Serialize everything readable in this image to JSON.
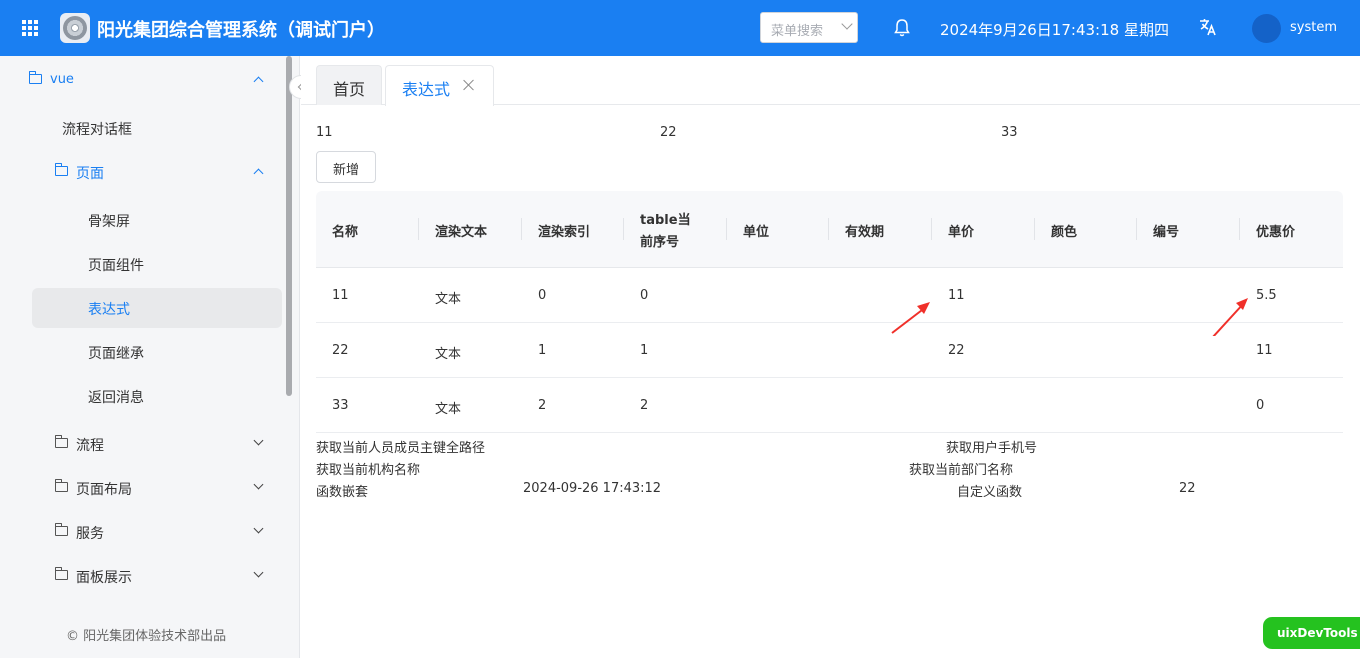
{
  "header": {
    "title": "阳光集团综合管理系统（调试门户）",
    "menu_search_placeholder": "菜单搜索",
    "datetime": "2024年9月26日17:43:18 星期四",
    "username": "system",
    "icons": [
      "apps-grid-icon",
      "logo-disc-icon",
      "bell-icon",
      "translate-icon",
      "avatar"
    ]
  },
  "sidebar": {
    "items": [
      {
        "label": "vue",
        "level": 0,
        "expanded": true
      },
      {
        "label": "流程对话框",
        "level": 1
      },
      {
        "label": "页面",
        "level": 1,
        "expanded": true
      },
      {
        "label": "骨架屏",
        "level": 2
      },
      {
        "label": "页面组件",
        "level": 2
      },
      {
        "label": "表达式",
        "level": 2,
        "selected": true
      },
      {
        "label": "页面继承",
        "level": 2
      },
      {
        "label": "返回消息",
        "level": 2
      },
      {
        "label": "流程",
        "level": 1,
        "expanded": false
      },
      {
        "label": "页面布局",
        "level": 1,
        "expanded": false
      },
      {
        "label": "服务",
        "level": 1,
        "expanded": false
      },
      {
        "label": "面板展示",
        "level": 1,
        "expanded": false
      }
    ],
    "footer": "© 阳光集团体验技术部出品"
  },
  "tabs": [
    {
      "label": "首页",
      "active": false
    },
    {
      "label": "表达式",
      "active": true,
      "closable": true
    }
  ],
  "main": {
    "top_values": [
      "11",
      "22",
      "33"
    ],
    "add_button": "新增",
    "table": {
      "headers": [
        "名称",
        "渲染文本",
        "渲染索引",
        "table当前序号",
        "单位",
        "有效期",
        "单价",
        "颜色",
        "编号",
        "优惠价"
      ],
      "rows": [
        [
          "11",
          "文本",
          "0",
          "0",
          "",
          "",
          "11",
          "",
          "",
          "5.5"
        ],
        [
          "22",
          "文本",
          "1",
          "1",
          "",
          "",
          "22",
          "",
          "",
          "11"
        ],
        [
          "33",
          "文本",
          "2",
          "2",
          "",
          "",
          "",
          "",
          "",
          "0"
        ]
      ]
    },
    "info": {
      "current_user_path_label": "获取当前人员成员主键全路径",
      "user_phone_label": "获取用户手机号",
      "current_org_label": "获取当前机构名称",
      "current_dept_label": "获取当前部门名称",
      "func_nest_label": "函数嵌套",
      "func_nest_value": "2024-09-26 17:43:12",
      "custom_func_label": "自定义函数",
      "custom_func_value": "22"
    }
  },
  "dev_badge": "uixDevTools",
  "colors": {
    "primary": "#1a7ff2",
    "header_bg": "#1a7ff2",
    "sidebar_bg": "#f5f6f8",
    "arrow_red": "#f0302a",
    "dev_badge_green": "#25c21f"
  }
}
